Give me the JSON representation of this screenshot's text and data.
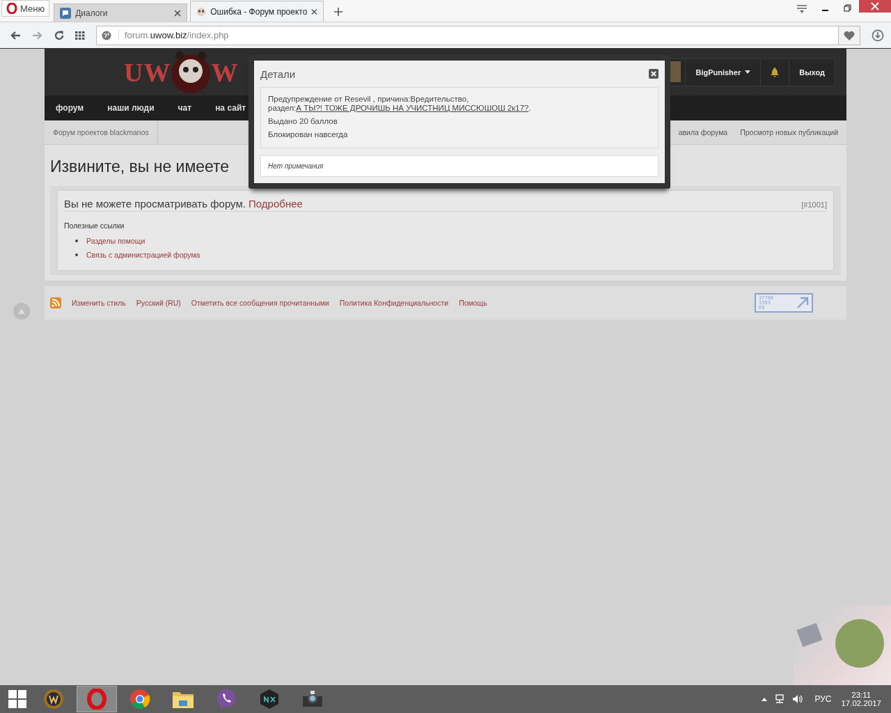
{
  "browser": {
    "menu_label": "Меню",
    "tabs": [
      {
        "label": "Диалоги",
        "kind": "chat",
        "selected": false
      },
      {
        "label": "Ошибка - Форум проекто",
        "kind": "forum",
        "selected": true
      }
    ],
    "address": {
      "prefix": "forum.",
      "domain": "uwow.biz",
      "path": "/index.php"
    }
  },
  "header": {
    "logo": {
      "left": "UW",
      "right": "W"
    },
    "user": {
      "name": "BigPunisher",
      "logout": "Выход"
    }
  },
  "nav": [
    {
      "label": "форум"
    },
    {
      "label": "наши люди"
    },
    {
      "label": "чат"
    },
    {
      "label": "на сайт"
    }
  ],
  "breadcrumb": {
    "crumb": "Форум проектов blackmanos",
    "links": [
      "авила форума",
      "Просмотр новых публикаций"
    ]
  },
  "heading": "Извините, вы не имеете",
  "error": {
    "text": "Вы не можете просматривать форум.",
    "link": "Подробнее",
    "code": "[#1001]",
    "useful_title": "Полезные ссылки",
    "links": [
      "Разделы помощи",
      "Связь с администрацией форума"
    ]
  },
  "footer": {
    "links": [
      "Изменить стиль",
      "Русский (RU)",
      "Отметить все сообщения прочитанными",
      "Политика Конфиденциальности",
      "Помощь"
    ],
    "counter": [
      "37768",
      "3393",
      "69"
    ]
  },
  "modal": {
    "title": "Детали",
    "message": {
      "before": "Предупреждение от Resevil , причина:Вредительство, раздел:",
      "link": "А ТЫ?! ТОЖЕ ДРОЧИШЬ НА УЧИСТНИЦ МИССЮШОШ 2к17?",
      "after": "."
    },
    "lines": [
      "Выдано 20 баллов",
      "Блокирован навсегда"
    ],
    "note": "Нет примечания"
  },
  "taskbar": {
    "apps": [
      {
        "kind": "wow",
        "selected": false
      },
      {
        "kind": "opera",
        "selected": true
      },
      {
        "kind": "chrome",
        "selected": false
      },
      {
        "kind": "folder",
        "selected": false
      },
      {
        "kind": "viber",
        "selected": false
      },
      {
        "kind": "nox",
        "selected": false
      },
      {
        "kind": "camera",
        "selected": false
      }
    ],
    "language": "РУС",
    "time": "23:11",
    "date": "17.02.2017"
  }
}
